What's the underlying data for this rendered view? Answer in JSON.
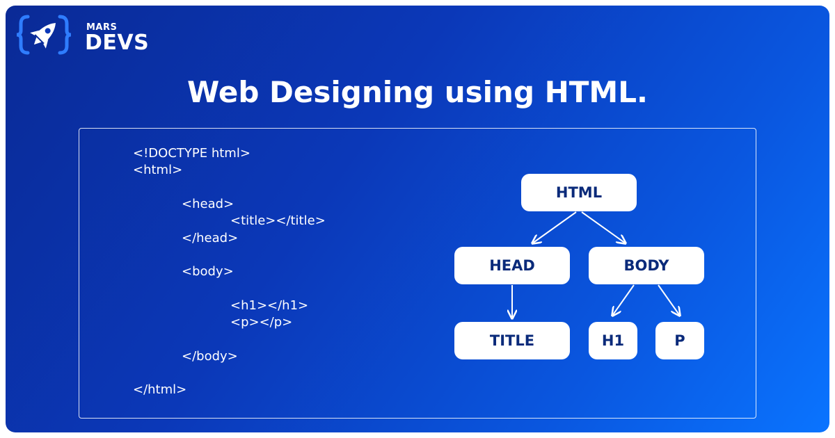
{
  "logo": {
    "small": "MARS",
    "big": "DEVS",
    "icon": "rocket-icon"
  },
  "title": "Web Designing using HTML.",
  "code_lines": [
    "<!DOCTYPE html>",
    "<html>",
    "<head>",
    "<title></title>",
    "</head>",
    "<body>",
    "<h1></h1>",
    "<p></p>",
    "</body>",
    "</html>"
  ],
  "tree": {
    "nodes": {
      "html": "HTML",
      "head": "HEAD",
      "body": "BODY",
      "title": "TITLE",
      "h1": "H1",
      "p": "P"
    }
  },
  "colors": {
    "background_start": "#0a2a96",
    "background_end": "#0a74ff",
    "node_fill": "#ffffff",
    "node_text": "#0a2a7a"
  }
}
